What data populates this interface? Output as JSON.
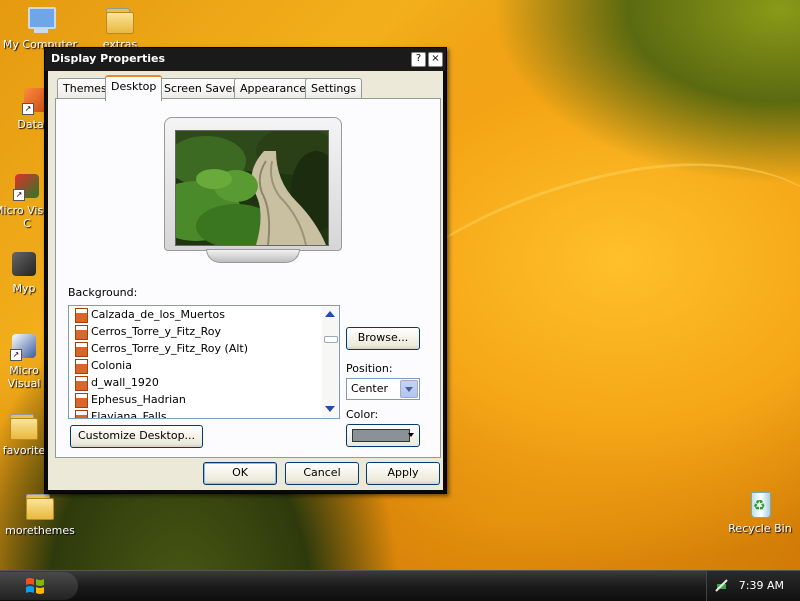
{
  "desktop": {
    "icons": [
      {
        "label": "My Computer"
      },
      {
        "label": "extras"
      },
      {
        "label": "DataW"
      },
      {
        "label": "Micro Visual C"
      },
      {
        "label": "Myp"
      },
      {
        "label": "Micro Visual"
      },
      {
        "label": "favorite"
      },
      {
        "label": "morethemes"
      },
      {
        "label": "Recycle Bin"
      }
    ]
  },
  "window": {
    "title": "Display Properties",
    "help_glyph": "?",
    "close_glyph": "×",
    "tabs": [
      {
        "label": "Themes"
      },
      {
        "label": "Desktop"
      },
      {
        "label": "Screen Saver"
      },
      {
        "label": "Appearance"
      },
      {
        "label": "Settings"
      }
    ],
    "active_tab": "Desktop",
    "background_label": "Background:",
    "background_items": [
      {
        "label": "Calzada_de_los_Muertos"
      },
      {
        "label": "Cerros_Torre_y_Fitz_Roy"
      },
      {
        "label": "Cerros_Torre_y_Fitz_Roy (Alt)"
      },
      {
        "label": "Colonia"
      },
      {
        "label": "d_wall_1920"
      },
      {
        "label": "Ephesus_Hadrian"
      },
      {
        "label": "Flaviana_Falls"
      }
    ],
    "browse_label": "Browse...",
    "position_label": "Position:",
    "position_value": "Center",
    "color_label": "Color:",
    "color_value": "#8b9199",
    "customize_label": "Customize Desktop...",
    "ok_label": "OK",
    "cancel_label": "Cancel",
    "apply_label": "Apply"
  },
  "taskbar": {
    "clock": "7:39 AM"
  },
  "colors": {
    "window_frame": "#0a0a0a",
    "dialog_face": "#ece9d8",
    "active_tab_accent": "#e68b2c",
    "desktop_primary": "#f3b01c"
  }
}
